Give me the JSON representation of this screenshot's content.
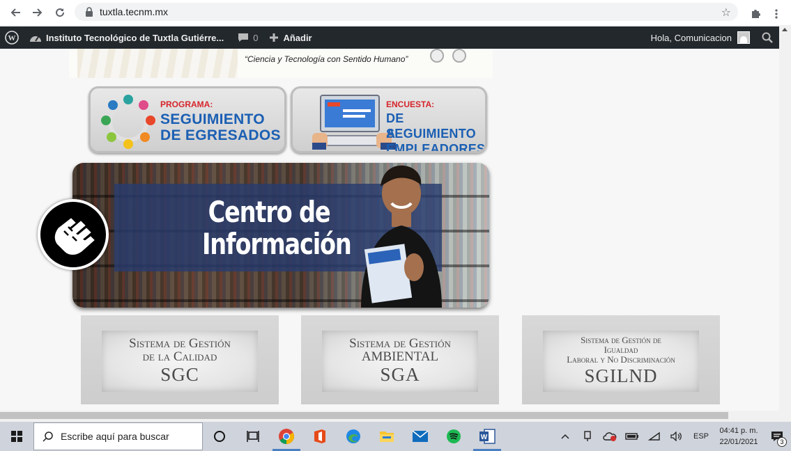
{
  "browser": {
    "url": "tuxtla.tecnm.mx"
  },
  "wp_admin": {
    "site_name": "Instituto Tecnológico de Tuxtla Gutiérre...",
    "comments_count": "0",
    "new_label": "Añadir",
    "greeting": "Hola, Comunicacion"
  },
  "header": {
    "slogan": "“Ciencia y Tecnología con Sentido Humano”"
  },
  "banners": {
    "egresados": {
      "small": "PROGRAMA:",
      "line1": "SEGUIMIENTO",
      "line2": "DE EGRESADOS"
    },
    "empleadores": {
      "small": "ENCUESTA:",
      "line1": "DE SEGUIMIENTO",
      "line2": "A EMPLEADORES"
    },
    "centro": {
      "line1": "Centro de",
      "line2": "Información"
    }
  },
  "systems": [
    {
      "l1": "Sistema de Gestión",
      "l2": "de la Calidad",
      "acronym": "SGC"
    },
    {
      "l1": "Sistema de Gestión",
      "l2": "AMBIENTAL",
      "acronym": "SGA"
    },
    {
      "l1": "Sistema de Gestión de",
      "l2": "Igualdad",
      "l3": "Laboral y No Discriminación",
      "acronym": "SGILND"
    }
  ],
  "taskbar": {
    "search_placeholder": "Escribe aquí para buscar",
    "language": "ESP",
    "time": "04:41 p. m.",
    "date": "22/01/2021",
    "notifications": "3"
  },
  "colors": {
    "wp_bar": "#23282d",
    "banner_blue": "#1b5fb3",
    "banner_red": "#d6242a"
  }
}
